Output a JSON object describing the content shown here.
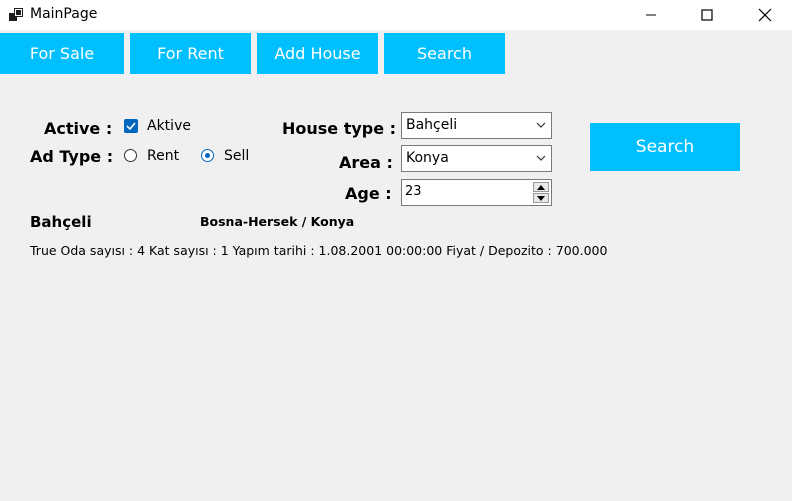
{
  "window": {
    "title": "MainPage"
  },
  "nav": {
    "for_sale": "For Sale",
    "for_rent": "For Rent",
    "add_house": "Add House",
    "search": "Search"
  },
  "filters": {
    "active_label": "Active :",
    "active_checkbox_label": "Aktive",
    "active_checked": true,
    "ad_type_label": "Ad Type :",
    "ad_type_options": [
      "Rent",
      "Sell"
    ],
    "ad_type_selected": "Sell",
    "house_type_label": "House type :",
    "house_type_value": "Bahçeli",
    "area_label": "Area :",
    "area_value": "Konya",
    "age_label": "Age :",
    "age_value": "23",
    "search_button": "Search"
  },
  "result": {
    "title": "Bahçeli",
    "location": "Bosna-Hersek / Konya",
    "details": "True  Oda sayısı : 4  Kat sayısı : 1  Yapım tarihi : 1.08.2001 00:00:00  Fiyat / Depozito : 700.000"
  },
  "colors": {
    "accent": "#00bfff",
    "control_blue": "#0067c0",
    "background": "#f0f0f0"
  }
}
